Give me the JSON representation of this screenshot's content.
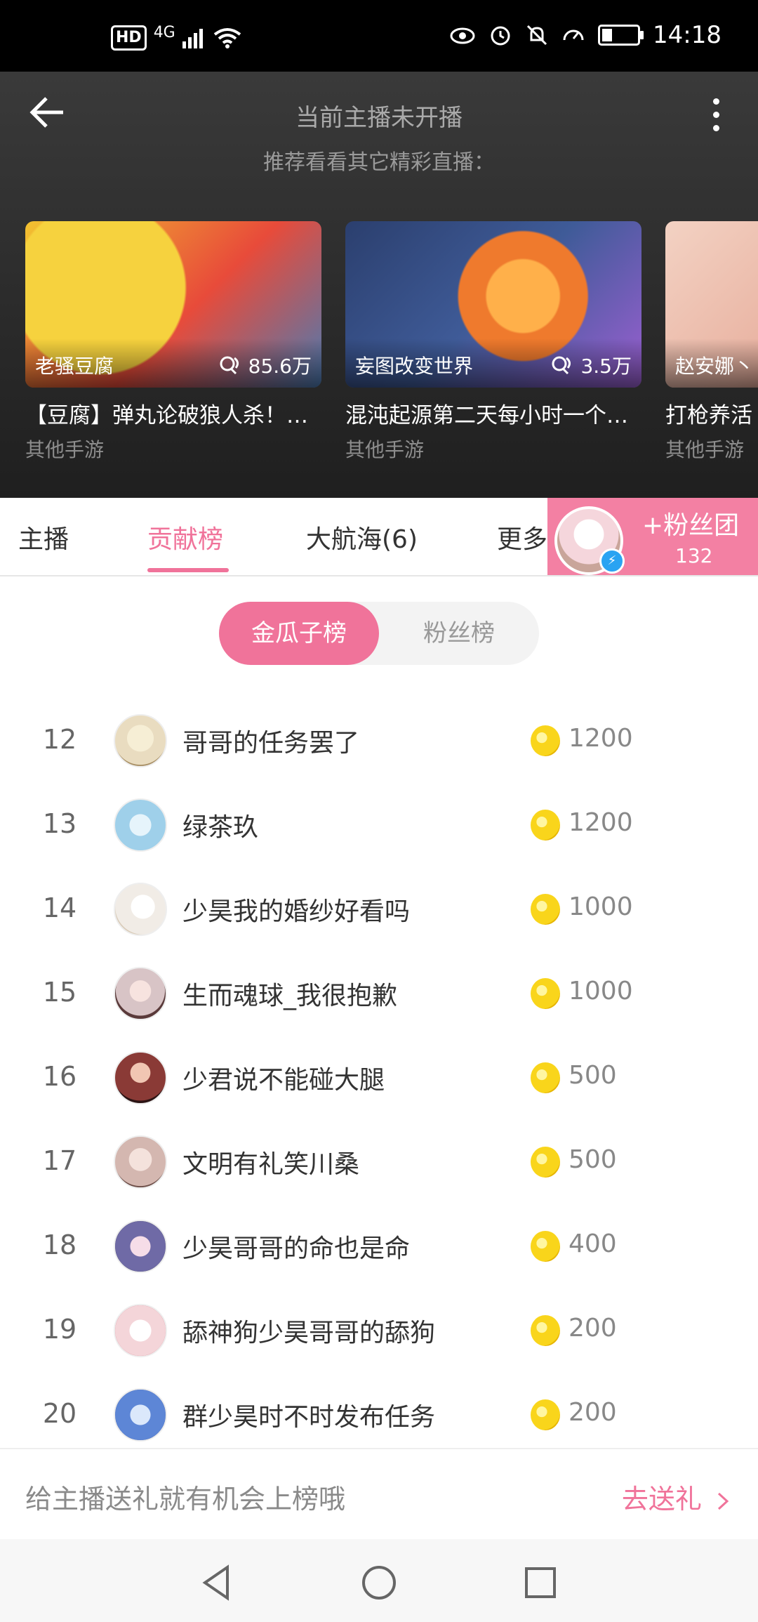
{
  "status_bar": {
    "network": "HD",
    "signal": "4G",
    "time": "14:18",
    "icons": [
      "hd-icon",
      "signal-icon",
      "wifi-icon",
      "eye-icon",
      "alarm-icon",
      "mute-icon",
      "speed-icon",
      "battery-icon"
    ]
  },
  "header": {
    "title": "当前主播未开播",
    "subtitle": "推荐看看其它精彩直播：",
    "back_icon": "arrow-left-icon",
    "menu_icon": "more-vertical-icon"
  },
  "cards": [
    {
      "host": "老骚豆腐",
      "views": "85.6万",
      "title": "【豆腐】弹丸论破狼人杀！…",
      "category": "其他手游",
      "thumb_colors": [
        "#f2c230",
        "#e84b3a",
        "#4a7bb3"
      ]
    },
    {
      "host": "妄图改变世界",
      "views": "3.5万",
      "title": "混沌起源第二天每小时一个…",
      "category": "其他手游",
      "thumb_colors": [
        "#2b3f6e",
        "#ef7a2d",
        "#9b5fd1"
      ]
    },
    {
      "host": "赵安娜丶",
      "views": "",
      "title": "打枪养活",
      "category": "其他手游",
      "thumb_colors": [
        "#f3d2c3",
        "#b05a4d",
        "#e9b3a2"
      ]
    }
  ],
  "tabs": [
    {
      "label": "主播"
    },
    {
      "label": "贡献榜"
    },
    {
      "label": "大航海(6)"
    },
    {
      "label": "更多"
    }
  ],
  "active_tab": "贡献榜",
  "fans_club": {
    "label": "+粉丝团",
    "count": "132"
  },
  "segmented": {
    "option1": "金瓜子榜",
    "option2": "粉丝榜"
  },
  "ranking": [
    {
      "rank": "12",
      "name": "哥哥的任务罢了",
      "score": "1200",
      "avatar_color": "#e9dcc0"
    },
    {
      "rank": "13",
      "name": "绿茶玖",
      "score": "1200",
      "avatar_color": "#9fd0ea"
    },
    {
      "rank": "14",
      "name": "少昊我的婚纱好看吗",
      "score": "1000",
      "avatar_color": "#f1ece6"
    },
    {
      "rank": "15",
      "name": "生而魂球_我很抱歉",
      "score": "1000",
      "avatar_color": "#d8c4c6"
    },
    {
      "rank": "16",
      "name": "少君说不能碰大腿",
      "score": "500",
      "avatar_color": "#8a3a36"
    },
    {
      "rank": "17",
      "name": "文明有礼笑川桑",
      "score": "500",
      "avatar_color": "#d4b7b0"
    },
    {
      "rank": "18",
      "name": "少昊哥哥的命也是命",
      "score": "400",
      "avatar_color": "#6f6aa6"
    },
    {
      "rank": "19",
      "name": "舔神狗少昊哥哥的舔狗",
      "score": "200",
      "avatar_color": "#f4d5d9"
    },
    {
      "rank": "20",
      "name": "群少昊时不时发布任务",
      "score": "200",
      "avatar_color": "#5d86d6"
    }
  ],
  "footer": {
    "prompt": "给主播送礼就有机会上榜哦",
    "action": "去送礼",
    "action_icon": "chevron-right-icon"
  },
  "navbar": {
    "icons": [
      "back-triangle-icon",
      "home-circle-icon",
      "recents-square-icon"
    ]
  },
  "accent": "#f0739a"
}
